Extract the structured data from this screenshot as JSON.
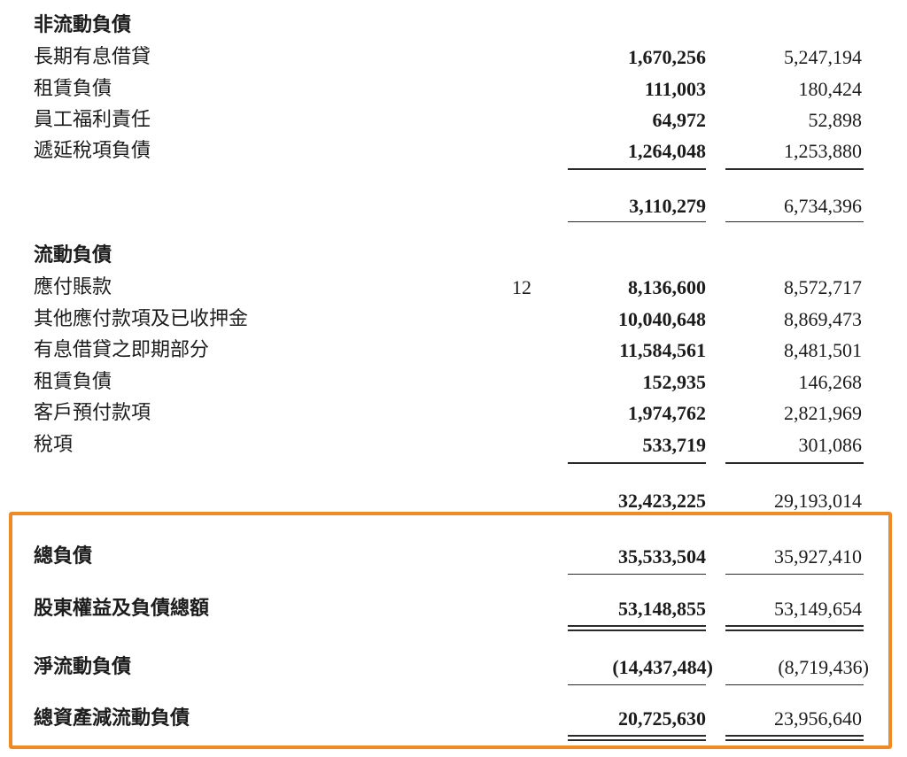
{
  "non_current": {
    "heading": "非流動負債",
    "rows": [
      {
        "label": "長期有息借貸",
        "note": "",
        "current": "1,670,256",
        "previous": "5,247,194"
      },
      {
        "label": "租賃負債",
        "note": "",
        "current": "111,003",
        "previous": "180,424"
      },
      {
        "label": "員工福利責任",
        "note": "",
        "current": "64,972",
        "previous": "52,898"
      },
      {
        "label": "遞延稅項負債",
        "note": "",
        "current": "1,264,048",
        "previous": "1,253,880"
      }
    ],
    "subtotal": {
      "current": "3,110,279",
      "previous": "6,734,396"
    }
  },
  "current": {
    "heading": "流動負債",
    "rows": [
      {
        "label": "應付賬款",
        "note": "12",
        "current": "8,136,600",
        "previous": "8,572,717"
      },
      {
        "label": "其他應付款項及已收押金",
        "note": "",
        "current": "10,040,648",
        "previous": "8,869,473"
      },
      {
        "label": "有息借貸之即期部分",
        "note": "",
        "current": "11,584,561",
        "previous": "8,481,501"
      },
      {
        "label": "租賃負債",
        "note": "",
        "current": "152,935",
        "previous": "146,268"
      },
      {
        "label": "客戶預付款項",
        "note": "",
        "current": "1,974,762",
        "previous": "2,821,969"
      },
      {
        "label": "稅項",
        "note": "",
        "current": "533,719",
        "previous": "301,086"
      }
    ],
    "subtotal": {
      "current": "32,423,225",
      "previous": "29,193,014"
    }
  },
  "totals": [
    {
      "label": "總負債",
      "current": "35,533,504",
      "previous": "35,927,410"
    },
    {
      "label": "股東權益及負債總額",
      "current": "53,148,855",
      "previous": "53,149,654"
    },
    {
      "label": "淨流動負債",
      "current": "(14,437,484)",
      "previous": "(8,719,436)"
    },
    {
      "label": "總資產減流動負債",
      "current": "20,725,630",
      "previous": "23,956,640"
    }
  ],
  "colors": {
    "highlight_border": "#f08a24",
    "text": "#1c1c1c"
  }
}
